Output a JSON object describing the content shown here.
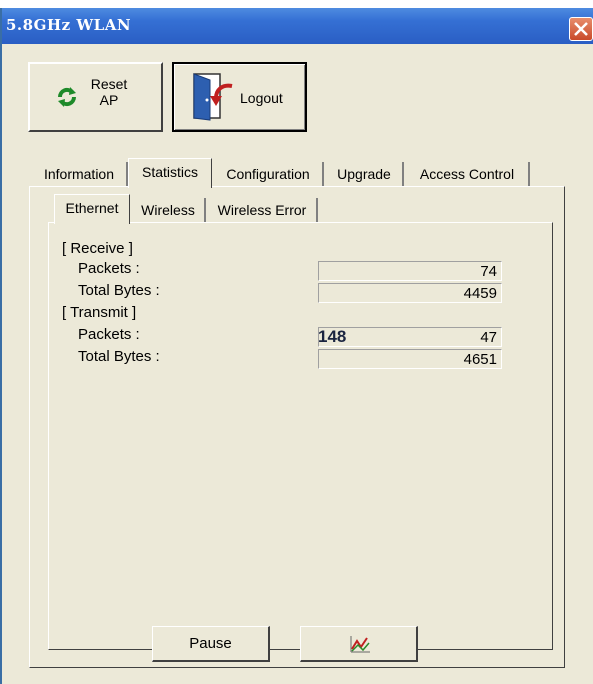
{
  "window": {
    "title": "5.8GHz WLAN"
  },
  "toolbar": {
    "reset_label": "Reset",
    "reset_label2": "AP",
    "logout_label": "Logout"
  },
  "main_tabs": [
    {
      "label": "Information",
      "active": false
    },
    {
      "label": "Statistics",
      "active": true
    },
    {
      "label": "Configuration",
      "active": false
    },
    {
      "label": "Upgrade",
      "active": false
    },
    {
      "label": "Access Control",
      "active": false
    }
  ],
  "sub_tabs": [
    {
      "label": "Ethernet",
      "active": true
    },
    {
      "label": "Wireless",
      "active": false
    },
    {
      "label": "Wireless Error",
      "active": false
    }
  ],
  "stats": {
    "receive_header": "[ Receive ]",
    "receive_packets_label": "Packets :",
    "receive_packets_value": "74",
    "receive_bytes_label": "Total Bytes :",
    "receive_bytes_value": "4459",
    "transmit_header": "[ Transmit ]",
    "transmit_packets_label": "Packets :",
    "transmit_packets_value": "47",
    "transmit_overlay_number": "148",
    "transmit_bytes_label": "Total Bytes :",
    "transmit_bytes_value": "4651"
  },
  "buttons": {
    "pause_label": "Pause",
    "chart_icon": "chart-icon"
  },
  "colors": {
    "titlebar": "#2a5ec4",
    "window_bg": "#ece9d8",
    "close_button": "#c94a2a"
  }
}
